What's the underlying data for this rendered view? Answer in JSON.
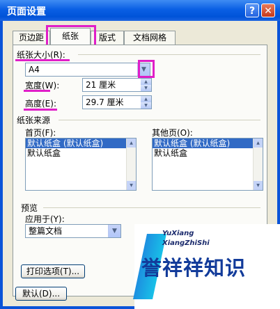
{
  "window": {
    "title": "页面设置",
    "help_icon": "?",
    "close_icon": "✕"
  },
  "tabs": [
    {
      "label": "页边距",
      "active": false
    },
    {
      "label": "纸张",
      "active": true
    },
    {
      "label": "版式",
      "active": false
    },
    {
      "label": "文档网格",
      "active": false
    }
  ],
  "paper_size": {
    "section_label": "纸张大小(R):",
    "value": "A4",
    "width_label": "宽度(W):",
    "width_value": "21 厘米",
    "height_label": "高度(E):",
    "height_value": "29.7 厘米"
  },
  "paper_source": {
    "section_label": "纸张来源",
    "first_page_label": "首页(F):",
    "first_page_items": [
      "默认纸盒 (默认纸盒)",
      "默认纸盒"
    ],
    "other_pages_label": "其他页(O):",
    "other_pages_items": [
      "默认纸盒 (默认纸盒)",
      "默认纸盒"
    ]
  },
  "preview": {
    "section_label": "预览",
    "apply_to_label": "应用于(Y):",
    "apply_to_value": "整篇文档"
  },
  "buttons": {
    "print_options": "打印选项(T)...",
    "default": "默认(D)..."
  },
  "watermark": {
    "text": "誉祥祥知识",
    "small1": "YuXiang",
    "small2": "XiangZhiShi"
  },
  "colors": {
    "highlight": "#e01ec8",
    "title_bar": "#0a53d8",
    "dialog_bg": "#ece9d8"
  }
}
